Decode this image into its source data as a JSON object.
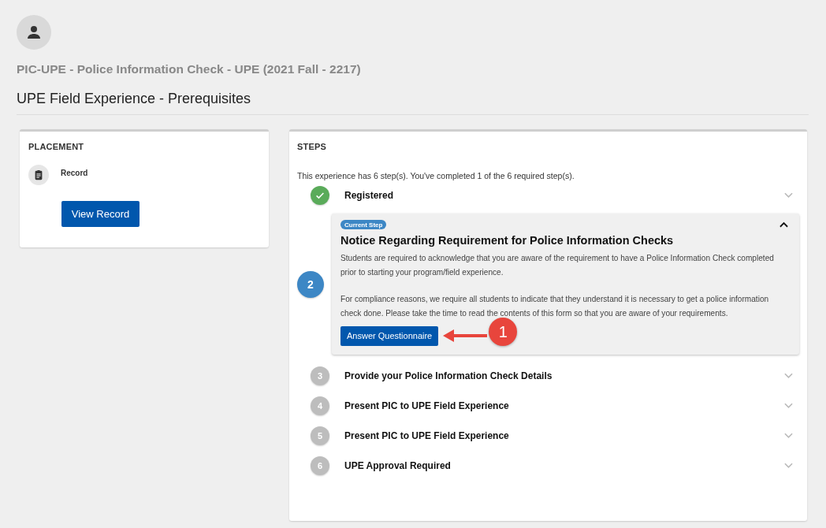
{
  "header": {
    "course_title": "PIC-UPE - Police Information Check - UPE (2021 Fall - 2217)",
    "page_title": "UPE Field Experience - Prerequisites"
  },
  "placement": {
    "heading": "PLACEMENT",
    "item_label": "Record",
    "button": "View Record"
  },
  "steps": {
    "heading": "STEPS",
    "summary": "This experience has 6 step(s). You've completed 1 of the 6 required step(s).",
    "items": [
      {
        "title": "Registered",
        "kind": "done",
        "expanded": false
      },
      {
        "number": "2",
        "title": "Notice Regarding Requirement for Police Information Checks",
        "kind": "current",
        "expanded": true,
        "badge": "Current Step",
        "paragraphs": [
          "Students are required to acknowledge that you are aware of the requirement to have a Police Information Check completed prior to starting your program/field experience.",
          "For compliance reasons, we require all students to indicate that they understand it is necessary to get a police information check done. Please take the time to read the contents of this form so that you are aware of your requirements."
        ],
        "button": "Answer Questionnaire"
      },
      {
        "number": "3",
        "title": "Provide your Police Information Check Details",
        "kind": "pending",
        "expanded": false
      },
      {
        "number": "4",
        "title": "Present PIC to UPE Field Experience",
        "kind": "pending",
        "expanded": false
      },
      {
        "number": "5",
        "title": "Present PIC to UPE Field Experience",
        "kind": "pending",
        "expanded": false
      },
      {
        "number": "6",
        "title": "UPE Approval Required",
        "kind": "pending",
        "expanded": false
      }
    ]
  },
  "callout": {
    "number": "1"
  }
}
